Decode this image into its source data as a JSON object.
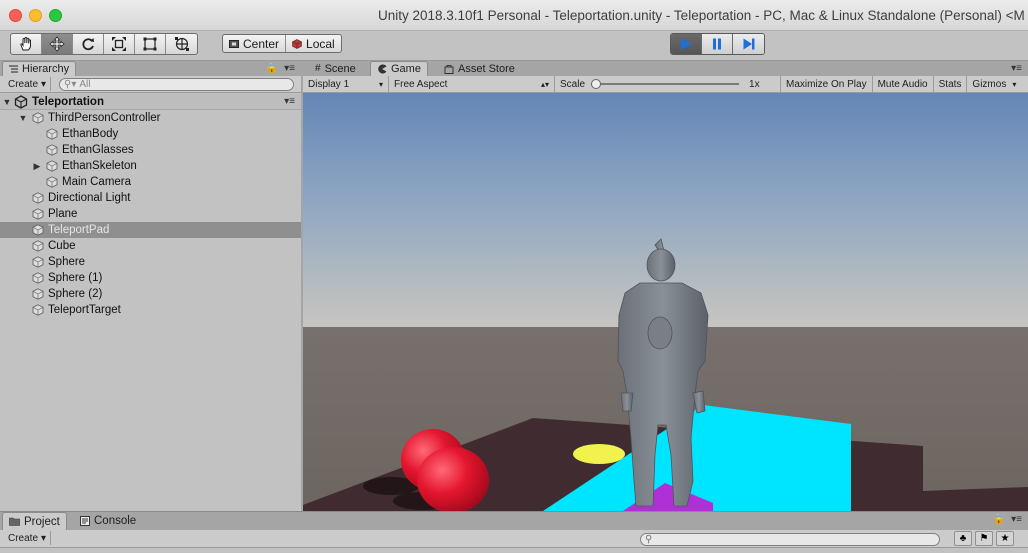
{
  "window": {
    "title": "Unity 2018.3.10f1 Personal - Teleportation.unity - Teleportation - PC, Mac & Linux Standalone (Personal) <M"
  },
  "toolbar": {
    "tools": [
      "hand-tool-icon",
      "move-tool-icon",
      "rotate-tool-icon",
      "scale-tool-icon",
      "rect-tool-icon",
      "transform-tool-icon"
    ],
    "pivot_label": "Center",
    "space_label": "Local",
    "playmode": [
      "play-icon",
      "pause-icon",
      "step-icon"
    ]
  },
  "hierarchy": {
    "tab_label": "Hierarchy",
    "create_label": "Create",
    "search_placeholder": "All",
    "scene_name": "Teleportation",
    "items": [
      {
        "label": "ThirdPersonController",
        "depth": 1,
        "expand": "expanded",
        "selected": false
      },
      {
        "label": "EthanBody",
        "depth": 2,
        "expand": "none",
        "selected": false
      },
      {
        "label": "EthanGlasses",
        "depth": 2,
        "expand": "none",
        "selected": false
      },
      {
        "label": "EthanSkeleton",
        "depth": 2,
        "expand": "collapsed",
        "selected": false
      },
      {
        "label": "Main Camera",
        "depth": 2,
        "expand": "none",
        "selected": false
      },
      {
        "label": "Directional Light",
        "depth": 1,
        "expand": "none",
        "selected": false
      },
      {
        "label": "Plane",
        "depth": 1,
        "expand": "none",
        "selected": false
      },
      {
        "label": "TeleportPad",
        "depth": 1,
        "expand": "none",
        "selected": true
      },
      {
        "label": "Cube",
        "depth": 1,
        "expand": "none",
        "selected": false
      },
      {
        "label": "Sphere",
        "depth": 1,
        "expand": "none",
        "selected": false
      },
      {
        "label": "Sphere (1)",
        "depth": 1,
        "expand": "none",
        "selected": false
      },
      {
        "label": "Sphere (2)",
        "depth": 1,
        "expand": "none",
        "selected": false
      },
      {
        "label": "TeleportTarget",
        "depth": 1,
        "expand": "none",
        "selected": false
      }
    ]
  },
  "game_tabs": {
    "scene": "Scene",
    "game": "Game",
    "asset_store": "Asset Store"
  },
  "game_bar": {
    "display": "Display 1",
    "aspect": "Free Aspect",
    "scale_label": "Scale",
    "scale_value": "1x",
    "maximize": "Maximize On Play",
    "mute": "Mute Audio",
    "stats": "Stats",
    "gizmos": "Gizmos"
  },
  "bottom": {
    "project_tab": "Project",
    "console_tab": "Console",
    "create_label": "Create"
  },
  "colors": {
    "selection": "#8f8f8f",
    "play_active": "#1e6fd9",
    "cyan_pad": "#00e5ff",
    "purple_pad": "#b030d8",
    "yellow_target": "#f2f24e",
    "red_sphere": "#e01530"
  }
}
